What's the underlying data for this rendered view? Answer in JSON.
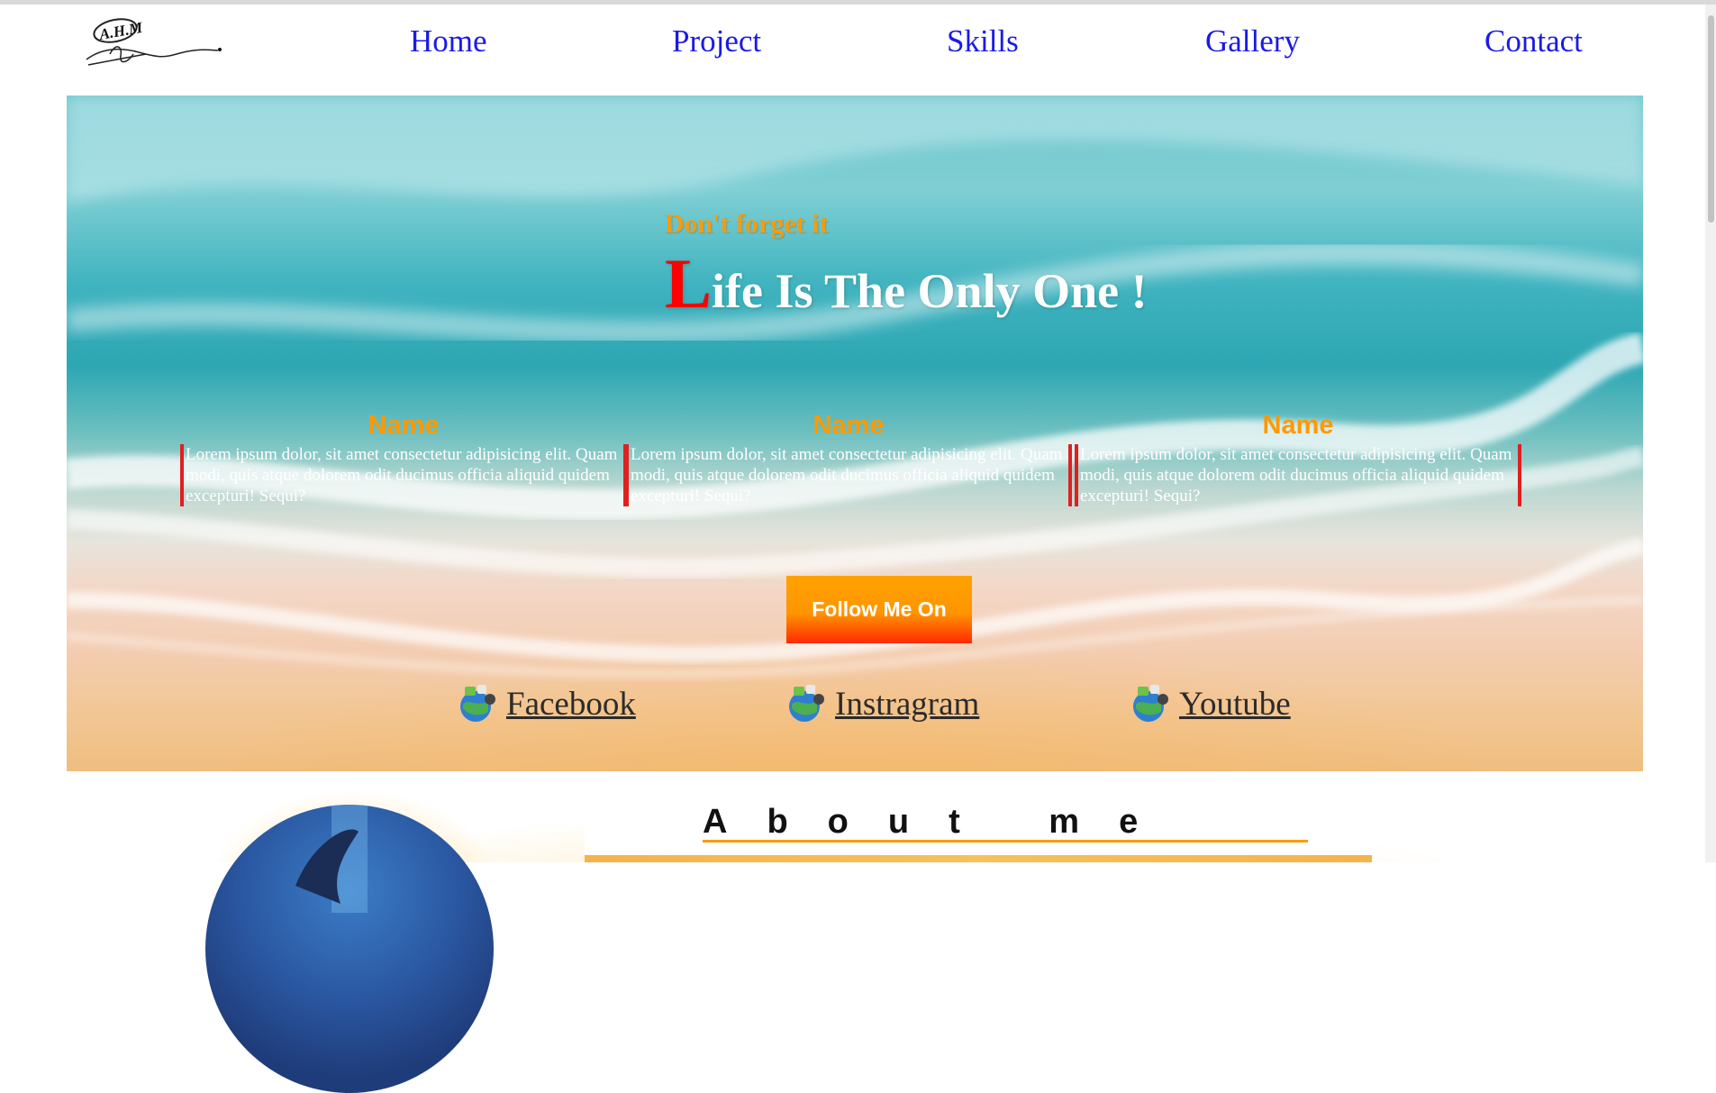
{
  "nav": {
    "logo_text": "A.H.M",
    "items": [
      {
        "label": "Home"
      },
      {
        "label": "Project"
      },
      {
        "label": "Skills"
      },
      {
        "label": "Gallery"
      },
      {
        "label": "Contact"
      }
    ]
  },
  "hero": {
    "tagline": "Don't forget it",
    "headline_cap": "L",
    "headline_rest": "ife Is The Only One !",
    "cards": [
      {
        "title": "Name",
        "text": "Lorem ipsum dolor, sit amet consectetur adipisicing elit. Quam modi, quis atque dolorem odit ducimus officia aliquid quidem excepturi! Sequi?"
      },
      {
        "title": "Name",
        "text": "Lorem ipsum dolor, sit amet consectetur adipisicing elit. Quam modi, quis atque dolorem odit ducimus officia aliquid quidem excepturi! Sequi?"
      },
      {
        "title": "Name",
        "text": "Lorem ipsum dolor, sit amet consectetur adipisicing elit. Quam modi, quis atque dolorem odit ducimus officia aliquid quidem excepturi! Sequi?"
      }
    ],
    "follow_label": "Follow Me On",
    "social": [
      {
        "label": "Facebook",
        "icon": "globe-apps-icon"
      },
      {
        "label": "Instragram",
        "icon": "globe-apps-icon"
      },
      {
        "label": "Youtube",
        "icon": "globe-apps-icon"
      }
    ]
  },
  "about": {
    "title": "About me"
  },
  "colors": {
    "nav_link": "#1a1ae6",
    "accent_orange": "#ff9900",
    "accent_red": "#ff0000"
  }
}
